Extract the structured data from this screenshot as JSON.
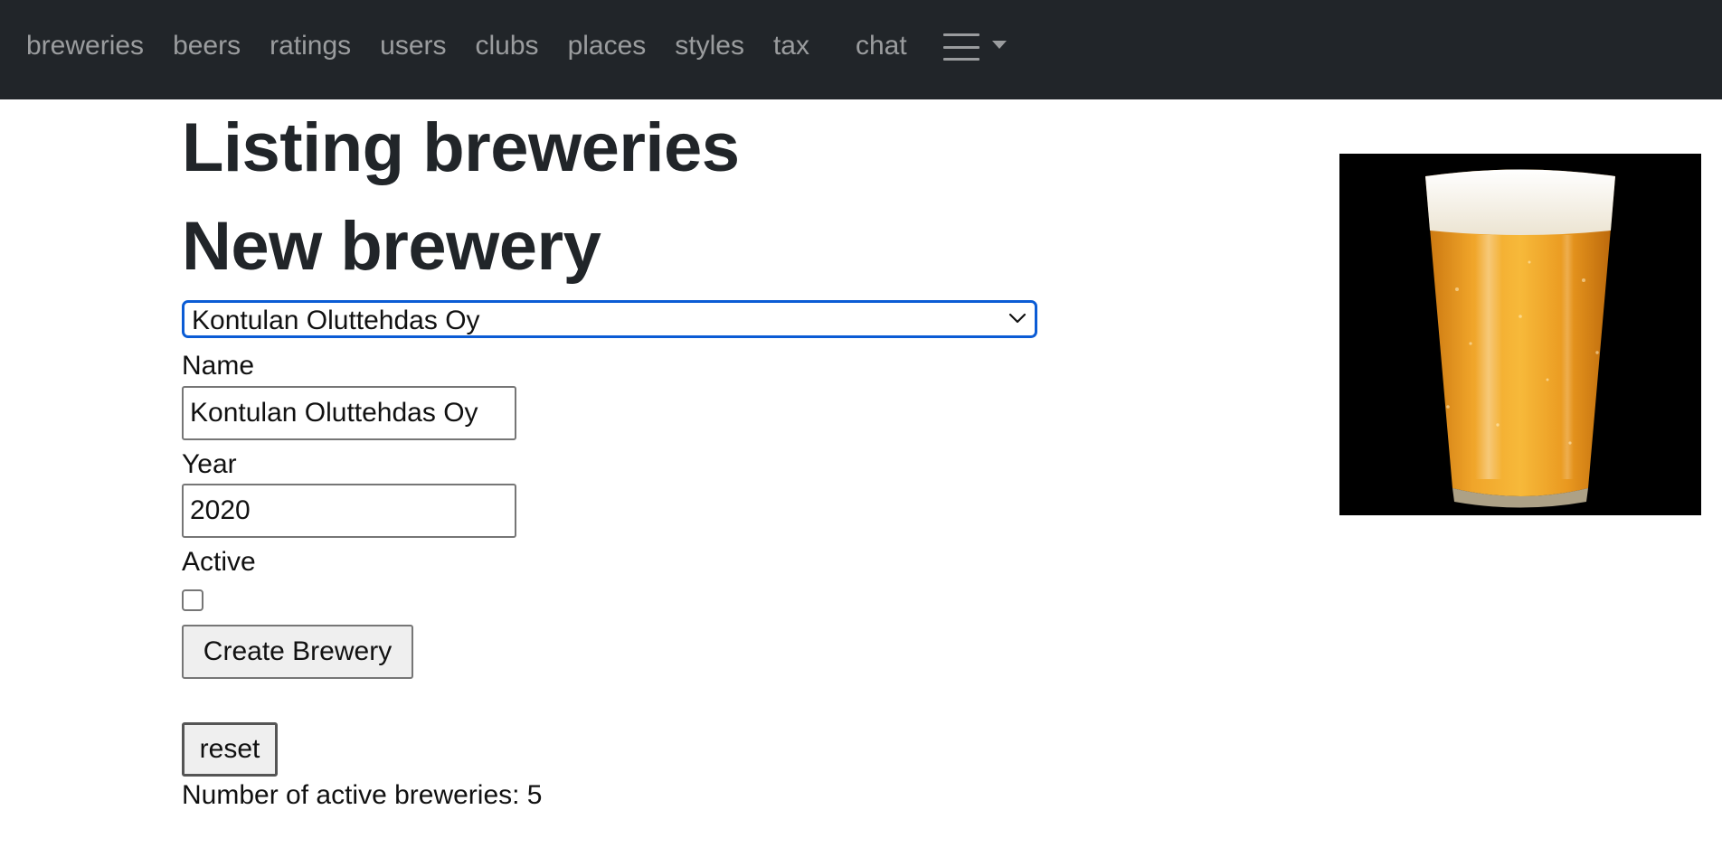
{
  "nav": {
    "links": [
      "breweries",
      "beers",
      "ratings",
      "users",
      "clubs",
      "places",
      "styles",
      "tax",
      "chat"
    ],
    "menu_icon": "hamburger-icon",
    "dropdown_icon": "caret-down-icon"
  },
  "main": {
    "page_title": "Listing breweries",
    "section_title": "New brewery",
    "brewery_select": {
      "selected": "Kontulan Oluttehdas Oy"
    },
    "form": {
      "name_label": "Name",
      "name_value": "Kontulan Oluttehdas Oy",
      "year_label": "Year",
      "year_value": "2020",
      "active_label": "Active",
      "active_checked": false,
      "submit_label": "Create Brewery"
    },
    "reset_label": "reset",
    "active_count_text": "Number of active breweries: 5"
  },
  "image": {
    "subject": "pint-of-beer"
  },
  "colors": {
    "navbar_bg": "#212529",
    "nav_link": "rgba(255,255,255,0.55)",
    "focus_border": "#0b5cd5",
    "text": "#212529"
  }
}
